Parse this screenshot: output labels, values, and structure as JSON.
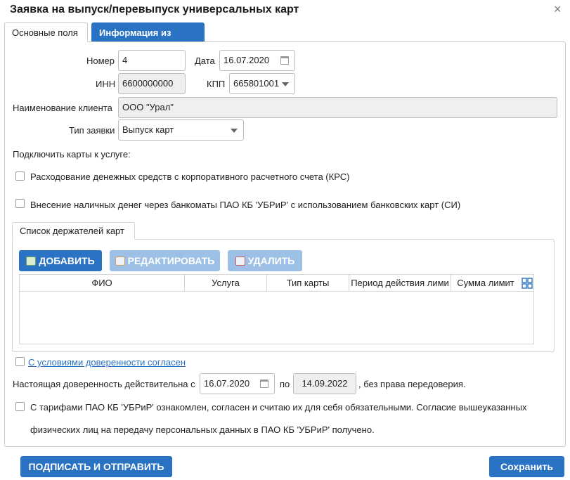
{
  "dialog": {
    "title": "Заявка на выпуск/перевыпуск универсальных карт",
    "close_glyph": "×"
  },
  "tabs": [
    {
      "label": "Основные поля",
      "active": true
    },
    {
      "label": "Информация из банка",
      "active": false
    }
  ],
  "form": {
    "number_label": "Номер",
    "number_value": "4",
    "date_label": "Дата",
    "date_value": "16.07.2020",
    "inn_label": "ИНН",
    "inn_value": "6600000000",
    "kpp_label": "КПП",
    "kpp_value": "665801001",
    "client_label": "Наименование клиента",
    "client_value": "ООО \"Урал\"",
    "type_label": "Тип заявки",
    "type_value": "Выпуск карт"
  },
  "services": {
    "heading": "Подключить карты к услуге:",
    "items": [
      "Расходование денежных средств с корпоративного расчетного счета (КРС)",
      "Внесение наличных денег через банкоматы ПАО КБ 'УБРиР' с использованием банковских карт (СИ)"
    ]
  },
  "holders": {
    "tab_label": "Список держателей карт",
    "add_label": "ДОБАВИТЬ",
    "edit_label": "РЕДАКТИРОВАТЬ",
    "delete_label": "УДАЛИТЬ",
    "columns": [
      "ФИО",
      "Услуга",
      "Тип карты",
      "Период действия лими",
      "Сумма лимит"
    ]
  },
  "agreement": {
    "link_label": "С условиями доверенности согласен",
    "validity_prefix": "Настоящая доверенность действительна с",
    "from_date": "16.07.2020",
    "to_label": "по",
    "to_date": "14.09.2022",
    "validity_suffix": ", без права передоверия.",
    "tariff_line1": "С тарифами ПАО КБ 'УБРиР' ознакомлен, согласен и считаю их для себя обязательными. Согласие вышеуказанных",
    "tariff_line2": "физических лиц на передачу персональных данных в ПАО КБ 'УБРиР' получено."
  },
  "footer": {
    "sign_label": "ПОДПИСАТЬ И ОТПРАВИТЬ",
    "save_label": "Сохранить"
  },
  "colors": {
    "accent": "#2a72c3",
    "accent_disabled": "#9cc0e6",
    "readonly_bg": "#efefef"
  }
}
